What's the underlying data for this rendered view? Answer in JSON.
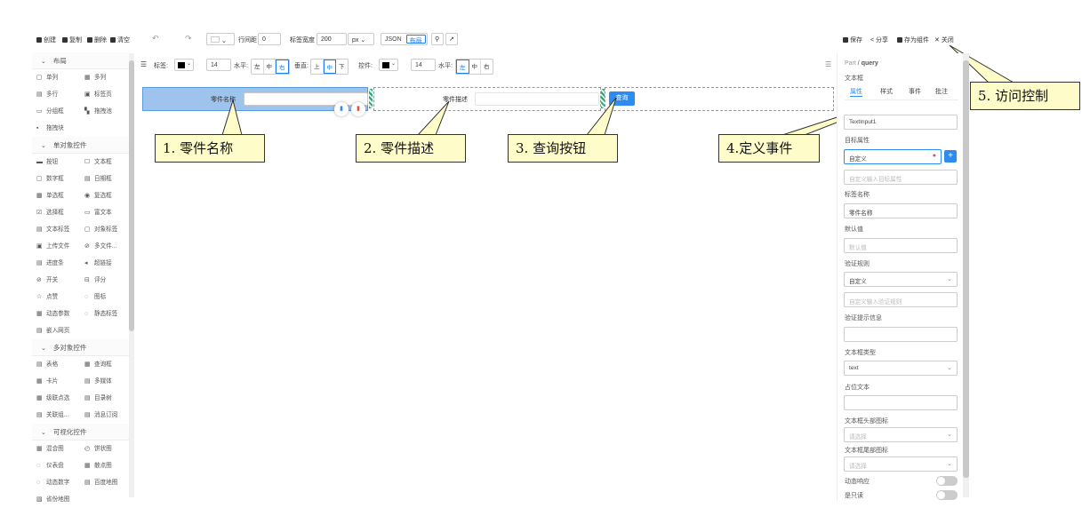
{
  "topbar": {
    "create": "创建",
    "copy": "复制",
    "delete": "删除",
    "clear": "清空",
    "row_spacing_label": "行间距",
    "row_spacing_value": "0",
    "label_width_label": "标签宽度",
    "label_width_value": "200",
    "label_width_unit": "px",
    "json_label": "JSON",
    "layout_label": "布局",
    "save": "保存",
    "share": "分享",
    "save_as_component": "存为组件",
    "close": "关闭"
  },
  "palette": {
    "groups": [
      {
        "title": "布局",
        "items": [
          "单列",
          "多列",
          "多行",
          "标签页",
          "分组框",
          "拖拽池",
          "拖拽块"
        ]
      },
      {
        "title": "单对象控件",
        "items": [
          "按钮",
          "文本框",
          "数字框",
          "日期框",
          "单选框",
          "复选框",
          "选择框",
          "富文本",
          "文本标签",
          "对象标签",
          "上传文件",
          "多文件...",
          "进度条",
          "超链接",
          "开关",
          "评分",
          "点赞",
          "图标",
          "动态参数",
          "静态标签",
          "嵌入网页"
        ]
      },
      {
        "title": "多对象控件",
        "items": [
          "表格",
          "查询框",
          "卡片",
          "多媒体",
          "级联点选",
          "目录树",
          "关联组...",
          "消息订阅"
        ]
      },
      {
        "title": "可视化控件",
        "items": [
          "混合图",
          "饼状图",
          "仪表盘",
          "散点图",
          "动态数字",
          "百度地图",
          "省份地图"
        ]
      }
    ]
  },
  "canvas_toolbar": {
    "label_text": "标签:",
    "font_size": "14",
    "horizontal": "水平:",
    "h_options": [
      "左",
      "中",
      "右"
    ],
    "h_selected": "右",
    "vertical": "垂直:",
    "v_options": [
      "上",
      "中",
      "下"
    ],
    "v_selected": "中",
    "control": "控件:",
    "control_font_size": "14",
    "control_horizontal": "水平:",
    "ch_options": [
      "左",
      "中",
      "右"
    ],
    "ch_selected": "左",
    "text_color": "#000000"
  },
  "canvas": {
    "field1_label": "零件名称",
    "field2_label": "零件描述",
    "query_button": "查询"
  },
  "callouts": {
    "c1": "1. 零件名称",
    "c2": "2. 零件描述",
    "c3": "3. 查询按钮",
    "c4": "4.定义事件",
    "c5": "5. 访问控制"
  },
  "right_panel": {
    "breadcrumb_part": "Part",
    "breadcrumb_name": "query",
    "section": "文本框",
    "tabs": [
      "属性",
      "样式",
      "事件",
      "批注"
    ],
    "tab_active": "属性",
    "control_id_value": "TextInput1",
    "target_attr_label": "目标属性",
    "target_attr_value": "自定义",
    "target_attr_placeholder": "自定义输入目标属性",
    "label_name_label": "标签名称",
    "label_name_value": "零件名称",
    "default_label": "默认值",
    "default_placeholder": "默认值",
    "validation_label": "验证规则",
    "validation_value": "自定义",
    "validation_placeholder": "自定义输入验证规则",
    "validation_msg_label": "验证提示信息",
    "textbox_type_label": "文本框类型",
    "textbox_type_value": "text",
    "placeholder_label": "占位文本",
    "head_icon_label": "文本框头部图标",
    "head_icon_placeholder": "请选择",
    "tail_icon_label": "文本框尾部图标",
    "tail_icon_placeholder": "请选择",
    "dynamic_label": "动态响应",
    "readonly_label": "是只读"
  },
  "colors": {
    "accent": "#2d8cf0",
    "selected_cell": "#9ec4ee",
    "callout_bg": "#fefcc9"
  }
}
